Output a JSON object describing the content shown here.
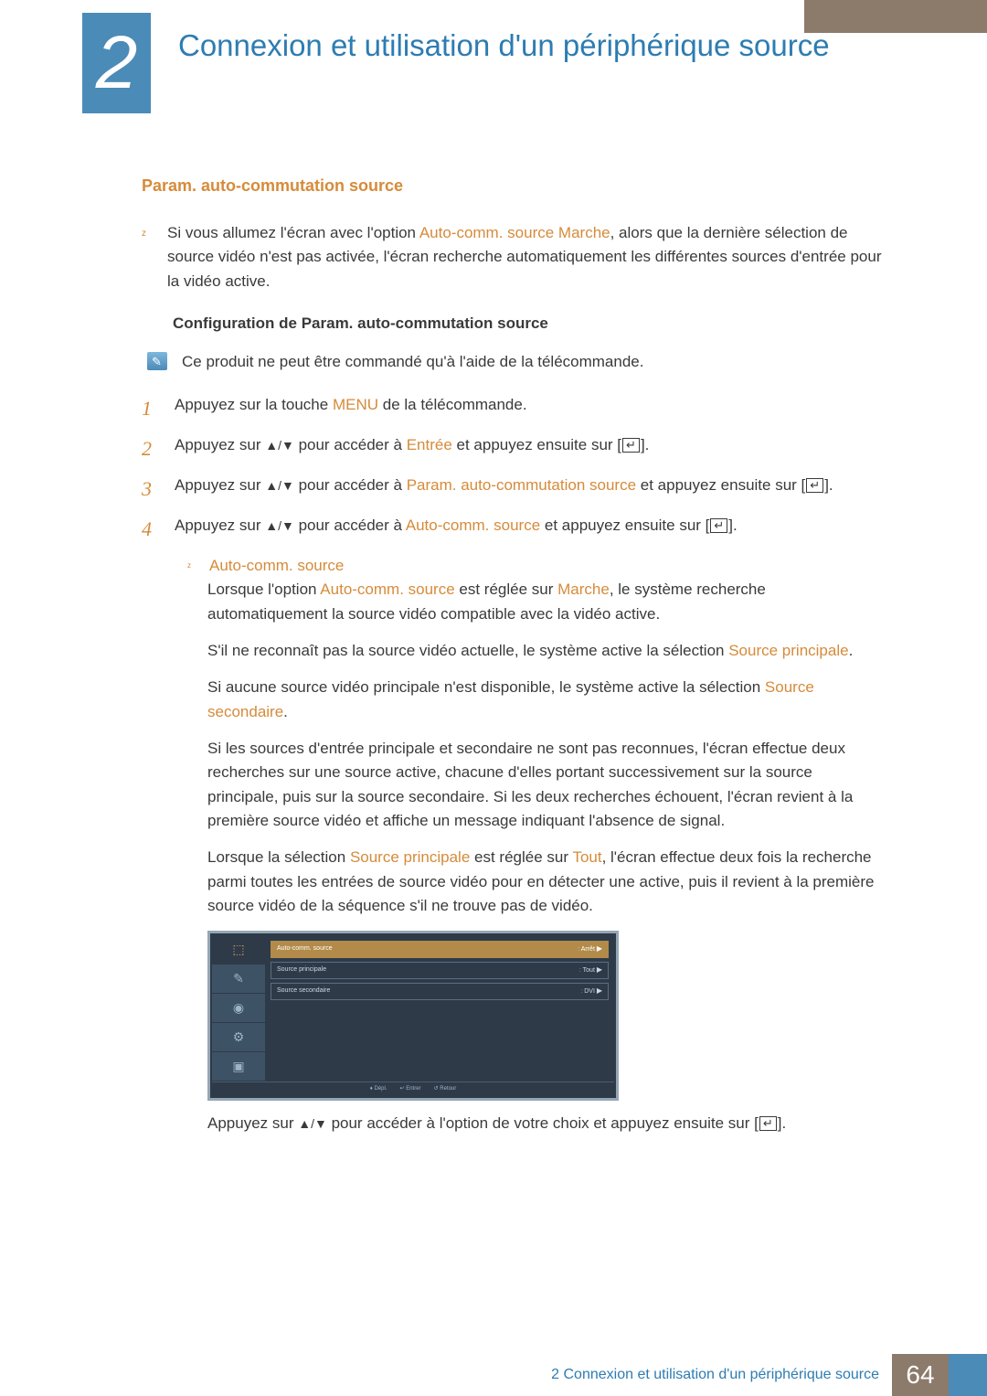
{
  "chapter": {
    "number": "2",
    "title": "Connexion et utilisation d'un périphérique source"
  },
  "section": {
    "heading": "Param. auto-commutation source"
  },
  "intro": {
    "pre": "Si vous allumez l'écran avec l'option ",
    "hl": "Auto-comm. source Marche",
    "post": ", alors que la dernière sélection de source vidéo n'est pas activée, l'écran recherche automatiquement les différentes sources d'entrée pour la vidéo active."
  },
  "subhead": "Configuration de Param. auto-commutation source",
  "note": "Ce produit ne peut être commandé qu'à l'aide de la télécommande.",
  "steps": {
    "s1": {
      "pre": "Appuyez sur la touche ",
      "hl": "MENU",
      "post": " de la télécommande."
    },
    "s2": {
      "pre": "Appuyez sur ",
      "arrows": "▲/▼",
      "mid": " pour accéder à ",
      "hl": "Entrée",
      "post": " et appuyez ensuite sur [",
      "tail": "]."
    },
    "s3": {
      "pre": "Appuyez sur ",
      "arrows": "▲/▼",
      "mid": " pour accéder à ",
      "hl": "Param. auto-commutation source",
      "post": " et appuyez ensuite sur [",
      "tail": "]."
    },
    "s4": {
      "pre": "Appuyez sur ",
      "arrows": "▲/▼",
      "mid": " pour accéder à ",
      "hl": "Auto-comm. source",
      "post": " et appuyez ensuite sur [",
      "tail": "]."
    }
  },
  "sub": {
    "title": "Auto-comm. source",
    "p1": {
      "a": "Lorsque l'option ",
      "hl1": "Auto-comm. source",
      "b": " est réglée sur ",
      "hl2": "Marche",
      "c": ", le système recherche automatiquement la source vidéo compatible avec la vidéo active."
    },
    "p2": {
      "a": "S'il ne reconnaît pas la source vidéo actuelle, le système active la sélection ",
      "hl": "Source principale",
      "b": "."
    },
    "p3": {
      "a": "Si aucune source vidéo principale n'est disponible, le système active la sélection ",
      "hl": "Source secondaire",
      "b": "."
    },
    "p4": "Si les sources d'entrée principale et secondaire ne sont pas reconnues, l'écran effectue deux recherches sur une source active, chacune d'elles portant successivement sur la source principale, puis sur la source secondaire. Si les deux recherches échouent, l'écran revient à la première source vidéo et affiche un message indiquant l'absence de signal.",
    "p5": {
      "a": "Lorsque la sélection ",
      "hl1": "Source principale",
      "b": " est réglée sur ",
      "hl2": "Tout",
      "c": ", l'écran effectue deux fois la recherche parmi toutes les entrées de source vidéo pour en détecter une active, puis il revient à la première source vidéo de la séquence s'il ne trouve pas de vidéo."
    }
  },
  "menu": {
    "row1": {
      "label": "Auto-comm. source",
      "sep": ":",
      "value": "Arrêt"
    },
    "row2": {
      "label": "Source principale",
      "sep": ":",
      "value": "Tout"
    },
    "row3": {
      "label": "Source secondaire",
      "sep": ":",
      "value": "DVI"
    },
    "footer": {
      "move": "Dépl.",
      "enter": "Entrer",
      "ret": "Retour"
    }
  },
  "after_menu": {
    "pre": "Appuyez sur ",
    "arrows": "▲/▼",
    "mid": " pour accéder à l'option de votre choix et appuyez ensuite sur [",
    "tail": "]."
  },
  "footer": {
    "text": "2 Connexion et utilisation d'un périphérique source",
    "page": "64"
  }
}
